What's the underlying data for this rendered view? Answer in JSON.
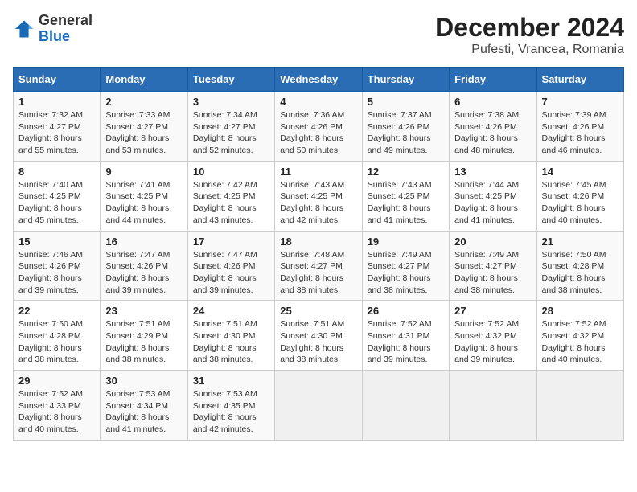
{
  "header": {
    "logo_general": "General",
    "logo_blue": "Blue",
    "title": "December 2024",
    "subtitle": "Pufesti, Vrancea, Romania"
  },
  "calendar": {
    "days_of_week": [
      "Sunday",
      "Monday",
      "Tuesday",
      "Wednesday",
      "Thursday",
      "Friday",
      "Saturday"
    ],
    "weeks": [
      [
        {
          "day": 1,
          "sunrise": "7:32 AM",
          "sunset": "4:27 PM",
          "daylight": "8 hours and 55 minutes."
        },
        {
          "day": 2,
          "sunrise": "7:33 AM",
          "sunset": "4:27 PM",
          "daylight": "8 hours and 53 minutes."
        },
        {
          "day": 3,
          "sunrise": "7:34 AM",
          "sunset": "4:27 PM",
          "daylight": "8 hours and 52 minutes."
        },
        {
          "day": 4,
          "sunrise": "7:36 AM",
          "sunset": "4:26 PM",
          "daylight": "8 hours and 50 minutes."
        },
        {
          "day": 5,
          "sunrise": "7:37 AM",
          "sunset": "4:26 PM",
          "daylight": "8 hours and 49 minutes."
        },
        {
          "day": 6,
          "sunrise": "7:38 AM",
          "sunset": "4:26 PM",
          "daylight": "8 hours and 48 minutes."
        },
        {
          "day": 7,
          "sunrise": "7:39 AM",
          "sunset": "4:26 PM",
          "daylight": "8 hours and 46 minutes."
        }
      ],
      [
        {
          "day": 8,
          "sunrise": "7:40 AM",
          "sunset": "4:25 PM",
          "daylight": "8 hours and 45 minutes."
        },
        {
          "day": 9,
          "sunrise": "7:41 AM",
          "sunset": "4:25 PM",
          "daylight": "8 hours and 44 minutes."
        },
        {
          "day": 10,
          "sunrise": "7:42 AM",
          "sunset": "4:25 PM",
          "daylight": "8 hours and 43 minutes."
        },
        {
          "day": 11,
          "sunrise": "7:43 AM",
          "sunset": "4:25 PM",
          "daylight": "8 hours and 42 minutes."
        },
        {
          "day": 12,
          "sunrise": "7:43 AM",
          "sunset": "4:25 PM",
          "daylight": "8 hours and 41 minutes."
        },
        {
          "day": 13,
          "sunrise": "7:44 AM",
          "sunset": "4:25 PM",
          "daylight": "8 hours and 41 minutes."
        },
        {
          "day": 14,
          "sunrise": "7:45 AM",
          "sunset": "4:26 PM",
          "daylight": "8 hours and 40 minutes."
        }
      ],
      [
        {
          "day": 15,
          "sunrise": "7:46 AM",
          "sunset": "4:26 PM",
          "daylight": "8 hours and 39 minutes."
        },
        {
          "day": 16,
          "sunrise": "7:47 AM",
          "sunset": "4:26 PM",
          "daylight": "8 hours and 39 minutes."
        },
        {
          "day": 17,
          "sunrise": "7:47 AM",
          "sunset": "4:26 PM",
          "daylight": "8 hours and 39 minutes."
        },
        {
          "day": 18,
          "sunrise": "7:48 AM",
          "sunset": "4:27 PM",
          "daylight": "8 hours and 38 minutes."
        },
        {
          "day": 19,
          "sunrise": "7:49 AM",
          "sunset": "4:27 PM",
          "daylight": "8 hours and 38 minutes."
        },
        {
          "day": 20,
          "sunrise": "7:49 AM",
          "sunset": "4:27 PM",
          "daylight": "8 hours and 38 minutes."
        },
        {
          "day": 21,
          "sunrise": "7:50 AM",
          "sunset": "4:28 PM",
          "daylight": "8 hours and 38 minutes."
        }
      ],
      [
        {
          "day": 22,
          "sunrise": "7:50 AM",
          "sunset": "4:28 PM",
          "daylight": "8 hours and 38 minutes."
        },
        {
          "day": 23,
          "sunrise": "7:51 AM",
          "sunset": "4:29 PM",
          "daylight": "8 hours and 38 minutes."
        },
        {
          "day": 24,
          "sunrise": "7:51 AM",
          "sunset": "4:30 PM",
          "daylight": "8 hours and 38 minutes."
        },
        {
          "day": 25,
          "sunrise": "7:51 AM",
          "sunset": "4:30 PM",
          "daylight": "8 hours and 38 minutes."
        },
        {
          "day": 26,
          "sunrise": "7:52 AM",
          "sunset": "4:31 PM",
          "daylight": "8 hours and 39 minutes."
        },
        {
          "day": 27,
          "sunrise": "7:52 AM",
          "sunset": "4:32 PM",
          "daylight": "8 hours and 39 minutes."
        },
        {
          "day": 28,
          "sunrise": "7:52 AM",
          "sunset": "4:32 PM",
          "daylight": "8 hours and 40 minutes."
        }
      ],
      [
        {
          "day": 29,
          "sunrise": "7:52 AM",
          "sunset": "4:33 PM",
          "daylight": "8 hours and 40 minutes."
        },
        {
          "day": 30,
          "sunrise": "7:53 AM",
          "sunset": "4:34 PM",
          "daylight": "8 hours and 41 minutes."
        },
        {
          "day": 31,
          "sunrise": "7:53 AM",
          "sunset": "4:35 PM",
          "daylight": "8 hours and 42 minutes."
        },
        null,
        null,
        null,
        null
      ]
    ]
  }
}
